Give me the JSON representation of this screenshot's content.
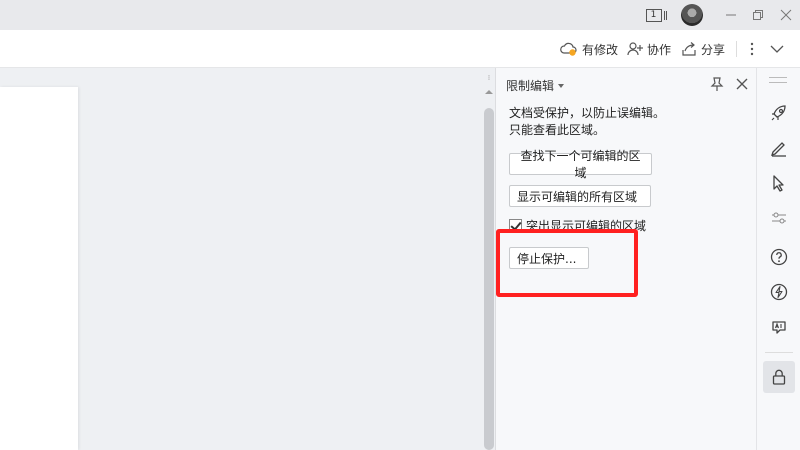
{
  "titlebar": {
    "page_indicator": "1"
  },
  "toolbar": {
    "modified_label": "有修改",
    "collab_label": "协作",
    "share_label": "分享"
  },
  "panel": {
    "title": "限制编辑",
    "description_line1": "文档受保护，以防止误编辑。",
    "description_line2": "只能查看此区域。",
    "find_next_label": "查找下一个可编辑的区域",
    "show_all_label": "显示可编辑的所有区域",
    "highlight_label": "突出显示可编辑的区域",
    "highlight_checked": true,
    "stop_protection_label": "停止保护..."
  },
  "sidebar": {
    "icons": [
      "rocket-icon",
      "pen-icon",
      "cursor-icon",
      "slider-icon",
      "help-icon",
      "lightning-icon",
      "ai-icon",
      "lock-icon"
    ]
  },
  "colors": {
    "annotation_red": "#ff2020",
    "modified_dot": "#f5a623"
  }
}
